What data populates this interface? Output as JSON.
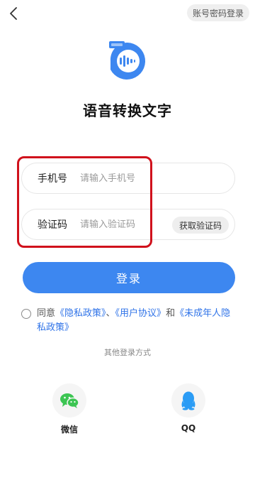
{
  "header": {
    "account_password_login": "账号密码登录"
  },
  "app": {
    "title": "语音转换文字"
  },
  "form": {
    "phone_label": "手机号",
    "phone_placeholder": "请输入手机号",
    "code_label": "验证码",
    "code_placeholder": "请输入验证码",
    "get_code_button": "获取验证码",
    "login_button": "登录"
  },
  "agreement": {
    "agree_text": "同意",
    "privacy_policy": "《隐私政策》",
    "separator": "、",
    "user_agreement": "《用户协议》",
    "and_text": "和",
    "minor_privacy_policy": "《未成年人隐私政策》"
  },
  "other_login": {
    "title": "其他登录方式",
    "wechat_label": "微信",
    "qq_label": "QQ"
  },
  "colors": {
    "primary": "#3d87f0",
    "link": "#2f73e8",
    "highlight": "#d0111c",
    "wechat": "#3cc552",
    "qq": "#2b9cf5"
  }
}
